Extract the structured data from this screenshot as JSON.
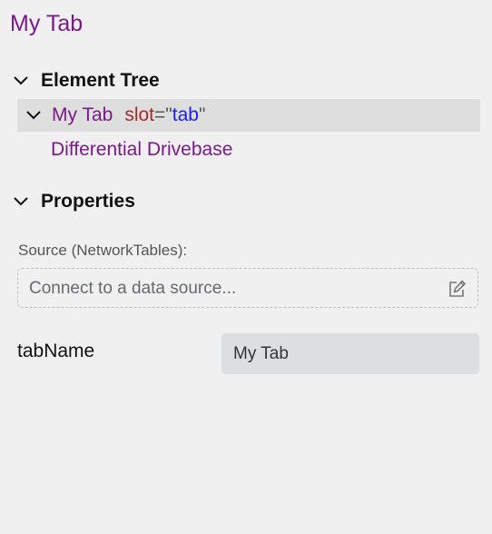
{
  "panel": {
    "title": "My Tab"
  },
  "element_tree": {
    "header_label": "Element Tree",
    "items": [
      {
        "name": "My Tab",
        "attr_name": "slot",
        "attr_eq": "=",
        "attr_quote_open": "\"",
        "attr_value": "tab",
        "attr_quote_close": "\"",
        "expanded": true,
        "selected": true
      },
      {
        "name": "Differential Drivebase"
      }
    ]
  },
  "properties": {
    "header_label": "Properties",
    "source_label": "Source (NetworkTables):",
    "source_placeholder": "Connect to a data source...",
    "fields": [
      {
        "label": "tabName",
        "value": "My Tab"
      }
    ]
  },
  "colors": {
    "background": "#f0f0f0",
    "element_name": "#7a1a8a",
    "attr_name": "#a52a2a",
    "attr_value": "#1a1aff",
    "selected_row": "#dedede",
    "input_bg": "#dcdee2"
  },
  "icons": {
    "section_toggle": "chevron-down-icon",
    "edit_source": "edit-icon"
  }
}
